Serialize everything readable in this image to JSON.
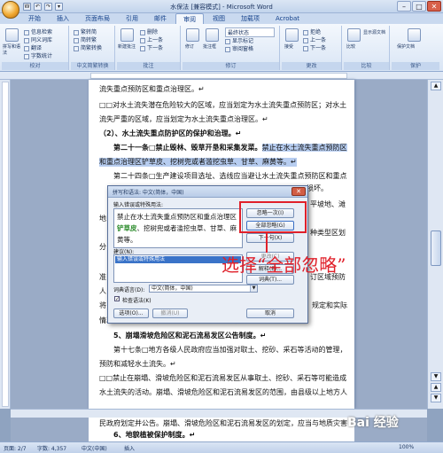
{
  "window": {
    "title": "水保法 [兼容模式] - Microsoft Word",
    "min": "–",
    "max": "□",
    "close": "✕"
  },
  "qat": [
    "W",
    "↶",
    "↷",
    "▾"
  ],
  "tabs": [
    "开始",
    "插入",
    "页面布局",
    "引用",
    "邮件",
    "审阅",
    "视图",
    "加载项",
    "Acrobat"
  ],
  "ribbon": {
    "groups": [
      "校对",
      "中文简繁转换",
      "批注",
      "修订",
      "更改",
      "比较",
      "保护"
    ],
    "proof_big": "拼写和语法",
    "proof_small": [
      "信息检索",
      "同义词库",
      "翻译",
      "翻译屏幕提示",
      "设置语言",
      "字数统计"
    ],
    "conv": [
      "繁转简",
      "简转繁",
      "简繁转换"
    ],
    "comment": [
      "新建批注",
      "删除",
      "上一条",
      "下一条"
    ],
    "track": [
      "修订",
      "批注框",
      "最终状态",
      "显示标记",
      "审阅窗格"
    ],
    "track_label": "最终状态",
    "change": [
      "接受",
      "拒绝",
      "上一条",
      "下一条"
    ],
    "compare": "比较",
    "protect": "保护文档",
    "user": "显示源文档"
  },
  "doc": {
    "lines": [
      "流失重点预防区和重点治理区。↵",
      "□□对水土流失潜在危险较大的区域，应当划定为水土流失重点预防区；对水土",
      "流失严重的区域，应当划定为水土流失重点治理区。↵",
      "（2）、水土流失重点防护区的保护和治理。↵",
      "第二十一条□禁止毁林、毁草开垦和采集发菜。",
      "禁止在水土流失重点预防区",
      "和重点治理区铲草皮、挖树兜或者滥挖虫草、甘草、麻黄等。↵",
      "第二十四条□生产建设项目选址、选线应当避让水土流失重点预防区和重点",
      "治理区；无法避让的，应当提高防治标准，优化施工工艺，减少地表扰动和植被",
      "损坏。",
      "平坡地、滩",
      "地",
      "种类型区划",
      "分",
      "订区域预防",
      "准",
      "人",
      "将",
      "规定和实际",
      "情况加强监督保护，防止破坏植被和生态环境的行为发生。↵",
      "5、崩塌滑坡危险区和泥石流易发区公告制度。↵",
      "第十七条□地方各级人民政府应当加强对取土、挖砂、采石等活动的管理，",
      "预防和减轻水土流失。↵",
      "□□禁止在崩塌、滑坡危险区和泥石流易发区从事取土、挖砂、采石等可能造成",
      "水土流失的活动。崩塌、滑坡危险区和泥石流易发区的范围，由县级以上地方人",
      "民政府划定并公告。崩塌、滑坡危险区和泥石流易发区的划定，应当与地质灾害",
      "防治规划确定的地质灾害易发区、重点防治区相衔接。↵",
      "6、地貌植被保护制度。↵"
    ]
  },
  "dialog": {
    "title": "拼写和语法: 中文(简体，中国)",
    "close": "✕",
    "input_label": "输入错误或特殊用法:",
    "text_before": "禁止在水土流失重点预防区和重点治理区",
    "text_error": "铲草皮",
    "text_after": "、挖树兜或者滥挖虫草、甘草、麻黄等。",
    "suggest_label": "建议(N):",
    "suggestion": "输入错误或特殊用法",
    "btn_ignore_once": "忽略一次(I)",
    "btn_ignore_all": "全部忽略(G)",
    "btn_next": "下一句(X)",
    "btn_change": "更改(C)",
    "btn_explain": "解释(E)...",
    "btn_change_all": "词典(T)...",
    "lang_label": "词典语言(D):",
    "lang_value": "中文(简体，中国)",
    "check_grammar": "检查语法(K)",
    "btn_options": "选项(O)...",
    "btn_undo": "撤消(U)",
    "btn_cancel": "取消"
  },
  "annotation": "选择“全部忽略”",
  "watermark": "Bai 经验",
  "status": {
    "page": "页面: 2/7",
    "words": "字数: 4,357",
    "lang": "中文(中国)",
    "mode": "插入",
    "zoom": "100%"
  }
}
